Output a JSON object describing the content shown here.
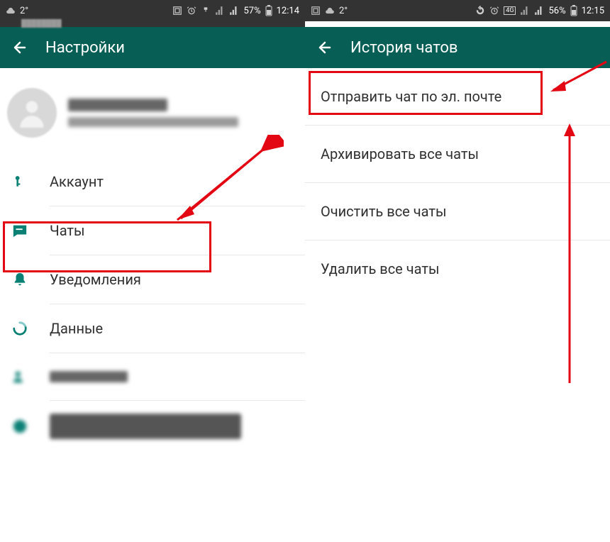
{
  "left": {
    "statusbar": {
      "temp": "2°",
      "battery": "57%",
      "time": "12:14"
    },
    "header": {
      "title": "Настройки"
    },
    "menu": {
      "account": "Аккаунт",
      "chats": "Чаты",
      "notifications": "Уведомления",
      "data": "Данные"
    }
  },
  "right": {
    "statusbar": {
      "temp": "2°",
      "battery": "56%",
      "time": "12:15"
    },
    "header": {
      "title": "История чатов"
    },
    "items": {
      "email": "Отправить чат по эл. почте",
      "archive": "Архивировать все чаты",
      "clear": "Очистить все чаты",
      "delete": "Удалить все чаты"
    }
  }
}
